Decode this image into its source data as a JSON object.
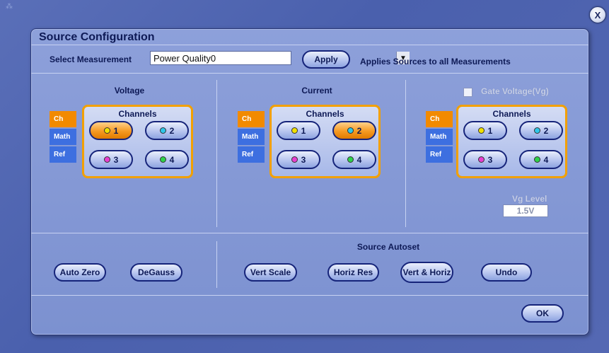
{
  "window": {
    "close_label": "X"
  },
  "dialog": {
    "title": "Source Configuration",
    "select_measurement_label": "Select Measurement",
    "measurement_value": "Power Quality0",
    "apply_label": "Apply",
    "apply_note": "Applies Sources to all Measurements"
  },
  "voltage": {
    "heading": "Voltage",
    "tabs": [
      "Ch",
      "Math",
      "Ref"
    ],
    "active_tab": "Ch",
    "channels_title": "Channels",
    "channels": [
      {
        "label": "1",
        "selected": true,
        "color": "#f0e000"
      },
      {
        "label": "2",
        "selected": false,
        "color": "#2fc6e8"
      },
      {
        "label": "3",
        "selected": false,
        "color": "#e83fd0"
      },
      {
        "label": "4",
        "selected": false,
        "color": "#2fd14a"
      }
    ]
  },
  "current": {
    "heading": "Current",
    "tabs": [
      "Ch",
      "Math",
      "Ref"
    ],
    "active_tab": "Ch",
    "channels_title": "Channels",
    "channels": [
      {
        "label": "1",
        "selected": false,
        "color": "#f0e000"
      },
      {
        "label": "2",
        "selected": true,
        "color": "#2fc6e8"
      },
      {
        "label": "3",
        "selected": false,
        "color": "#e83fd0"
      },
      {
        "label": "4",
        "selected": false,
        "color": "#2fd14a"
      }
    ]
  },
  "gate": {
    "checkbox_label": "Gate Voltage(Vg)",
    "checked": false,
    "tabs": [
      "Ch",
      "Math",
      "Ref"
    ],
    "active_tab": "Ch",
    "channels_title": "Channels",
    "channels": [
      {
        "label": "1",
        "selected": false,
        "color": "#f0e000"
      },
      {
        "label": "2",
        "selected": false,
        "color": "#2fc6e8"
      },
      {
        "label": "3",
        "selected": false,
        "color": "#e83fd0"
      },
      {
        "label": "4",
        "selected": false,
        "color": "#2fd14a"
      }
    ],
    "vg_level_label": "Vg Level",
    "vg_level_value": "1.5V"
  },
  "bottom": {
    "auto_zero_label": "Auto Zero",
    "degauss_label": "DeGauss",
    "source_autoset_heading": "Source Autoset",
    "vert_scale_label": "Vert Scale",
    "horiz_res_label": "Horiz Res",
    "vert_horiz_label": "Vert & Horiz",
    "undo_label": "Undo",
    "ok_label": "OK"
  }
}
